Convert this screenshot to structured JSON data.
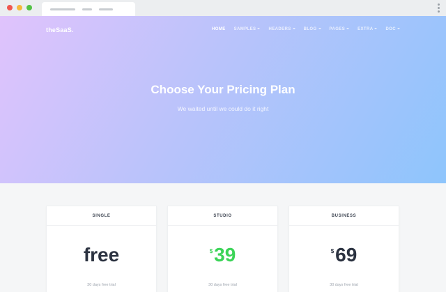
{
  "browser": {
    "window_dots": [
      "close",
      "minimize",
      "maximize"
    ]
  },
  "header": {
    "logo": "theSaaS.",
    "nav": [
      {
        "label": "HOME",
        "has_dropdown": false,
        "active": true
      },
      {
        "label": "SAMPLES",
        "has_dropdown": true,
        "active": false
      },
      {
        "label": "HEADERS",
        "has_dropdown": true,
        "active": false
      },
      {
        "label": "BLOG",
        "has_dropdown": true,
        "active": false
      },
      {
        "label": "PAGES",
        "has_dropdown": true,
        "active": false
      },
      {
        "label": "EXTRA",
        "has_dropdown": true,
        "active": false
      },
      {
        "label": "DOC",
        "has_dropdown": true,
        "active": false
      }
    ]
  },
  "hero": {
    "title": "Choose Your Pricing Plan",
    "subtitle": "We waited until we could do it right",
    "gradient_colors": [
      "#e0c3fc",
      "#8ec5fc"
    ]
  },
  "plans": [
    {
      "name": "SINGLE",
      "currency": "",
      "price": "free",
      "trial": "30 days free trial",
      "price_color": "#2b3240"
    },
    {
      "name": "STUDIO",
      "currency": "$",
      "price": "39",
      "trial": "30 days free trial",
      "price_color": "#3cd458"
    },
    {
      "name": "BUSINESS",
      "currency": "$",
      "price": "69",
      "trial": "30 days free trial",
      "price_color": "#2b3240"
    }
  ]
}
